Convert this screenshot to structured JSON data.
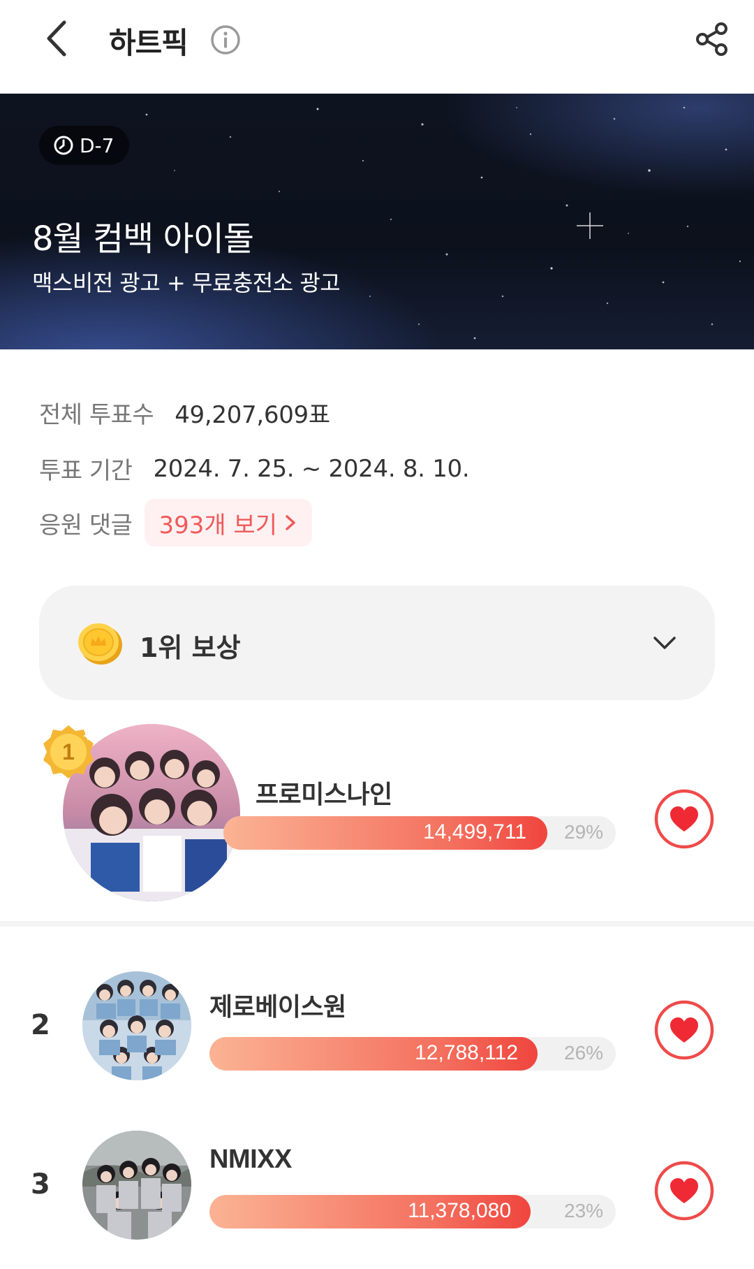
{
  "header": {
    "title": "하트픽"
  },
  "banner": {
    "dday": "D-7",
    "title": "8월 컴백 아이돌",
    "subtitle": "맥스비전 광고 + 무료충전소 광고"
  },
  "meta": {
    "total_votes_label": "전체 투표수",
    "total_votes_value": "49,207,609표",
    "period_label": "투표 기간",
    "period_value": "2024. 7. 25. ~ 2024. 8. 10.",
    "comments_label": "응원 댓글",
    "comments_button": "393개 보기"
  },
  "reward": {
    "title": "1위 보상"
  },
  "ranking": [
    {
      "rank": "1",
      "name": "프로미스나인",
      "votes": "14,499,711",
      "percent": "29%",
      "share": 0.29
    },
    {
      "rank": "2",
      "name": "제로베이스원",
      "votes": "12,788,112",
      "percent": "26%",
      "share": 0.26
    },
    {
      "rank": "3",
      "name": "NMIXX",
      "votes": "11,378,080",
      "percent": "23%",
      "share": 0.23
    }
  ],
  "colors": {
    "accent": "#ef4a4a",
    "bar_start": "#fbb394",
    "bar_end": "#f0453e",
    "comment_bg": "#fff1f1"
  },
  "icons": {
    "back": "chevron-left-icon",
    "info": "info-icon",
    "share": "share-icon",
    "clock": "clock-icon",
    "coin": "coin-icon",
    "expand": "chevron-down-icon",
    "heart": "heart-icon"
  }
}
